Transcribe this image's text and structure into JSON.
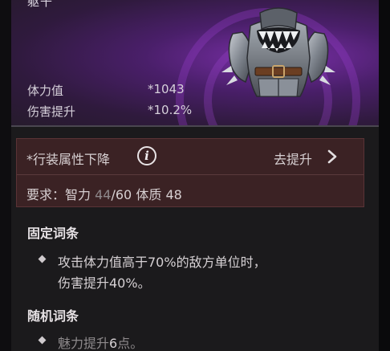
{
  "item": {
    "type_label": "躯干"
  },
  "stats": [
    {
      "label": "体力值",
      "value": "*1043"
    },
    {
      "label": "伤害提升",
      "value": "*10.2%"
    }
  ],
  "requirement_warning": {
    "title": "*行装属性下降",
    "info_icon_glyph": "i",
    "improve_label": "去提升",
    "requirement_prefix": "要求：",
    "attr1_name": "智力",
    "attr1_current": "44",
    "attr1_required": "/60",
    "attr2_name": "体质",
    "attr2_current": "48"
  },
  "fixed_affixes": {
    "title": "固定词条",
    "lines": [
      "攻击体力值高于70%的敌方单位时，",
      "伤害提升40%。"
    ]
  },
  "random_affixes": {
    "title": "随机词条",
    "line_prefix": "魅力提升",
    "line_number": "6",
    "line_suffix": "点。"
  },
  "colors": {
    "header_purple": "#4a1f6a",
    "warning_bg": "#3b2224",
    "panel_bg": "#1b1a1c"
  }
}
